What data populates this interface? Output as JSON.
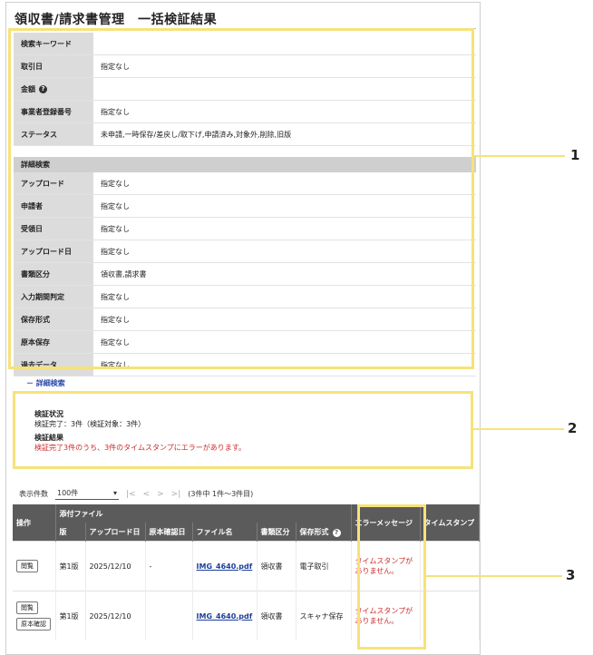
{
  "page": {
    "title": "領収書/請求書管理　一括検証結果"
  },
  "criteria": {
    "rows": [
      {
        "label": "検索キーワード",
        "value": ""
      },
      {
        "label": "取引日",
        "value": "指定なし"
      },
      {
        "label": "金額",
        "value": ""
      },
      {
        "label": "事業者登録番号",
        "value": "指定なし"
      },
      {
        "label": "ステータス",
        "value": "未申請,一時保存/差戻し/取下げ,申請済み,対象外,削除,旧版"
      }
    ],
    "detail_header": "詳細検索",
    "detail_rows": [
      {
        "label": "アップロード",
        "value": "指定なし"
      },
      {
        "label": "申請者",
        "value": "指定なし"
      },
      {
        "label": "受領日",
        "value": "指定なし"
      },
      {
        "label": "アップロード日",
        "value": "指定なし"
      },
      {
        "label": "書類区分",
        "value": "領収書,請求書"
      },
      {
        "label": "入力期間判定",
        "value": "指定なし"
      },
      {
        "label": "保存形式",
        "value": "指定なし"
      },
      {
        "label": "原本保存",
        "value": "指定なし"
      },
      {
        "label": "過去データ",
        "value": "指定なし"
      }
    ],
    "toggle_label": "－ 詳細検索"
  },
  "result": {
    "status_heading": "検証状況",
    "status_text": "検証完了：3件（検証対象：3件）",
    "result_heading": "検証結果",
    "result_text": "検証完了3件のうち、3件のタイムスタンプにエラーがあります。"
  },
  "pager": {
    "per_page_label": "表示件数",
    "per_page_value": "100件",
    "first": "|<",
    "prev": "<",
    "next": ">",
    "last": ">|",
    "summary": "(3件中 1件〜3件目)"
  },
  "table": {
    "group_header": "添付ファイル",
    "headers": {
      "action": "操作",
      "version": "版",
      "upload_date": "アップロード日",
      "original_date": "原本確認日",
      "file_name": "ファイル名",
      "doc_type": "書類区分",
      "storage": "保存形式",
      "error": "エラーメッセージ",
      "timestamp": "タイムスタンプ"
    },
    "rows": [
      {
        "buttons": [
          "閲覧"
        ],
        "version": "第1版",
        "upload_date": "2025/12/10",
        "original_date": "-",
        "file_name": "IMG_4640.pdf",
        "doc_type": "領収書",
        "storage": "電子取引",
        "error": "タイムスタンプがありません。"
      },
      {
        "buttons": [
          "閲覧",
          "原本確認"
        ],
        "version": "第1版",
        "upload_date": "2025/12/10",
        "original_date": "",
        "file_name": "IMG_4640.pdf",
        "doc_type": "領収書",
        "storage": "スキャナ保存",
        "error": "タイムスタンプがありません。"
      }
    ]
  },
  "callouts": {
    "one": "1",
    "two": "2",
    "three": "3"
  },
  "colors": {
    "highlight": "#f6e27a",
    "error": "#cc2a2a",
    "link": "#1d3f9a",
    "header_bg": "#5b5b5b"
  }
}
